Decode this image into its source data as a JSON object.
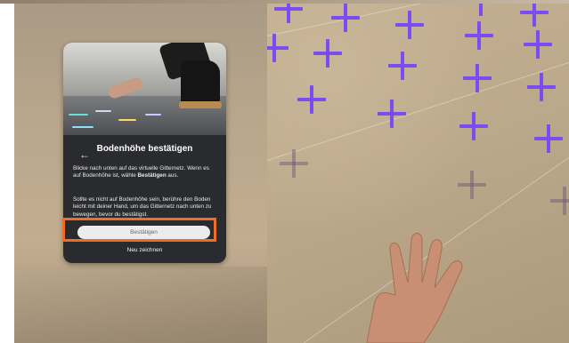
{
  "dialog": {
    "back_icon": "arrow-left-icon",
    "title": "Bodenhöhe bestätigen",
    "paragraph1_prefix": "Blicke nach unten auf das virtuelle Gitternetz. Wenn es auf Bodenhöhe ist, wähle ",
    "paragraph1_bold": "Bestätigen",
    "paragraph1_suffix": " aus.",
    "paragraph2": "Sollte es nicht auf Bodenhöhe sein, berühre den Boden leicht mit deiner Hand, um das Gitternetz nach unten zu bewegen, bevor du bestätigst.",
    "confirm_label": "Bestätigen",
    "redraw_label": "Neu zeichnen"
  },
  "colors": {
    "panel": "#2a2b2e",
    "grid_marker": "#7b4cf2",
    "highlight": "#ef6d24",
    "button": "#ececec"
  },
  "floor_grid": {
    "marker_icon": "plus-marker-icon"
  }
}
